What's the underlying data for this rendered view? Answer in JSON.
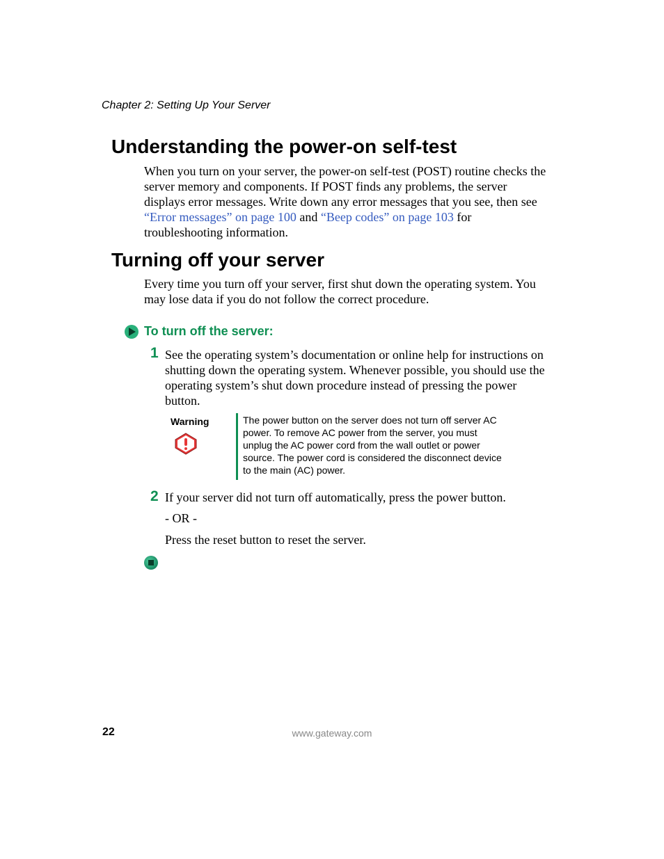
{
  "chapter": "Chapter 2: Setting Up Your Server",
  "section1": {
    "title": "Understanding the power-on self-test",
    "para_a": "When you turn on your server, the power-on self-test (POST) routine checks the server memory and components. If POST finds any problems, the server displays error messages. Write down any error messages that you see, then see ",
    "link1": "“Error messages” on page 100",
    "mid": " and ",
    "link2": "“Beep codes” on page 103",
    "tail": " for troubleshooting information."
  },
  "section2": {
    "title": "Turning off your server",
    "para": "Every time you turn off your server, first shut down the operating system. You may lose data if you do not follow the correct procedure."
  },
  "procedure": {
    "heading": "To turn off the server:",
    "step1_num": "1",
    "step1": "See the operating system’s documentation or online help for instructions on shutting down the operating system. Whenever possible, you should use the operating system’s shut down procedure instead of pressing the power button.",
    "warning_label": "Warning",
    "warning_text": "The power button on the server does not turn off server AC power. To remove AC power from the server, you must unplug the AC power cord from the wall outlet or power source. The power cord is considered the disconnect device to the main (AC) power.",
    "step2_num": "2",
    "step2": "If your server did not turn off automatically, press the power button.",
    "or": "- OR -",
    "step2b": "Press the reset button to reset the server."
  },
  "footer": {
    "page": "22",
    "url": "www.gateway.com"
  }
}
